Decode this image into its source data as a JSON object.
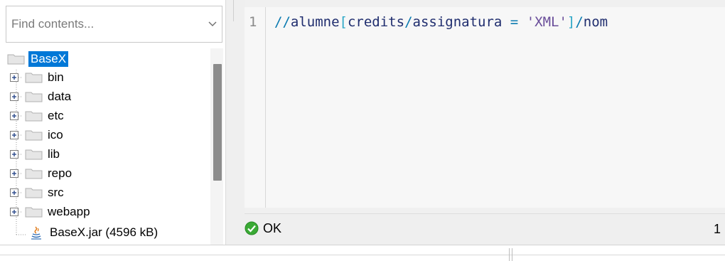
{
  "search": {
    "placeholder": "Find contents..."
  },
  "tree": {
    "root": {
      "label": "BaseX",
      "icon": "folder-open-icon"
    },
    "folders": [
      {
        "label": "bin"
      },
      {
        "label": "data"
      },
      {
        "label": "etc"
      },
      {
        "label": "ico"
      },
      {
        "label": "lib"
      },
      {
        "label": "repo"
      },
      {
        "label": "src"
      },
      {
        "label": "webapp"
      }
    ],
    "files": [
      {
        "label": "BaseX.jar (4596 kB)",
        "icon": "java-icon"
      }
    ]
  },
  "editor": {
    "line_number": "1",
    "tokens": {
      "t1": "//",
      "t2": "alumne",
      "t3": "[",
      "t4": "credits",
      "t5": "/",
      "t6": "assignatura",
      "t7": " = ",
      "t8": "'XML'",
      "t9": "]",
      "t10": "/",
      "t11": "nom"
    }
  },
  "status": {
    "text": "OK",
    "icon": "ok-check-icon",
    "right_value": "1"
  },
  "colors": {
    "selection": "#0078d7",
    "ok_green": "#3aaa35",
    "bracket": "#2aa6c6",
    "operator": "#0a7ab0",
    "name": "#1f2d6e",
    "string": "#6a4e9a"
  }
}
